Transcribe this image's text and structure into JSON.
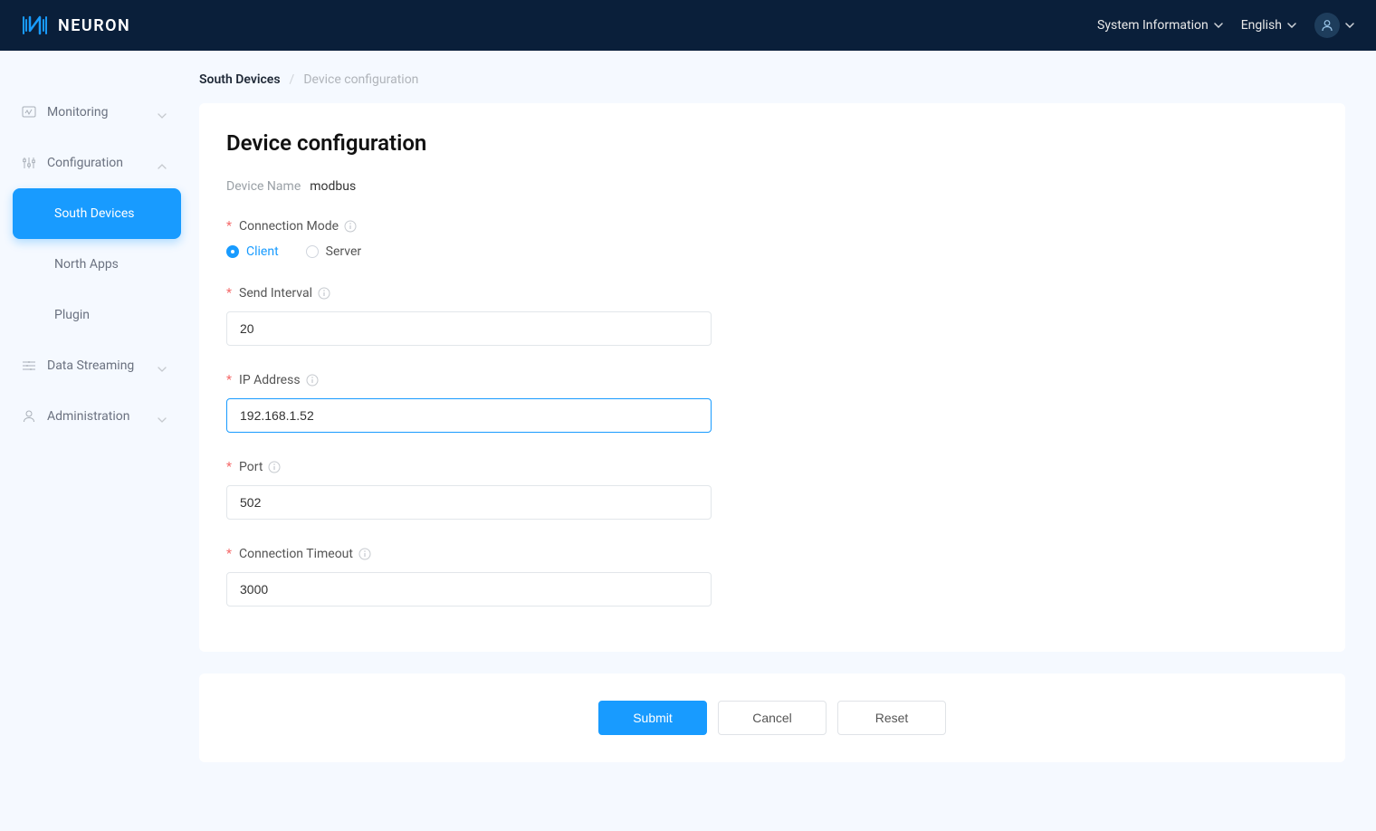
{
  "brand": {
    "name": "NEURON"
  },
  "header": {
    "system_info": "System Information",
    "language": "English"
  },
  "sidebar": {
    "monitoring": "Monitoring",
    "configuration": "Configuration",
    "south_devices": "South Devices",
    "north_apps": "North Apps",
    "plugin": "Plugin",
    "data_streaming": "Data Streaming",
    "administration": "Administration"
  },
  "breadcrumb": {
    "root": "South Devices",
    "current": "Device configuration"
  },
  "page": {
    "title": "Device configuration",
    "device_name_label": "Device Name",
    "device_name_value": "modbus"
  },
  "form": {
    "connection_mode": {
      "label": "Connection Mode",
      "options": {
        "client": "Client",
        "server": "Server"
      },
      "value": "client"
    },
    "send_interval": {
      "label": "Send Interval",
      "value": "20"
    },
    "ip_address": {
      "label": "IP Address",
      "value": "192.168.1.52"
    },
    "port": {
      "label": "Port",
      "value": "502"
    },
    "connection_timeout": {
      "label": "Connection Timeout",
      "value": "3000"
    }
  },
  "buttons": {
    "submit": "Submit",
    "cancel": "Cancel",
    "reset": "Reset"
  }
}
